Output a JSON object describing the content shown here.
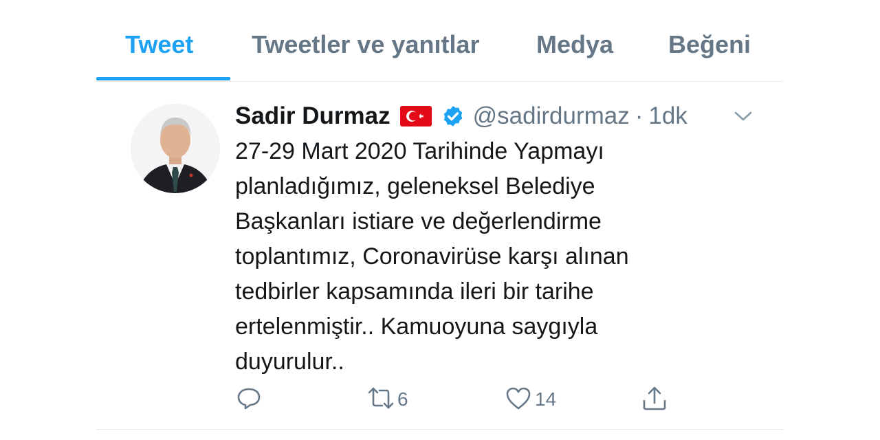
{
  "tabs": [
    {
      "label": "Tweet",
      "active": true
    },
    {
      "label": "Tweetler ve yanıtlar",
      "active": false
    },
    {
      "label": "Medya",
      "active": false
    },
    {
      "label": "Beğeni",
      "active": false
    }
  ],
  "tweet": {
    "author_name": "Sadir Durmaz",
    "handle": "@sadirdurmaz",
    "separator": "·",
    "time": "1dk",
    "text": "27-29 Mart 2020 Tarihinde Yapmayı\nplanladığımız, geleneksel Belediye\nBaşkanları istiare ve değerlendirme\ntoplantımız, Coronavirüse karşı alınan\ntedbirler kapsamında ileri bir tarihe\nertelenmiştir.. Kamuoyuna saygıyla\nduyurulur..",
    "retweet_count": "6",
    "like_count": "14"
  },
  "icons": {
    "flag": "turkey-flag-icon",
    "verified": "verified-badge-icon",
    "chevron": "chevron-down-icon",
    "reply": "reply-icon",
    "retweet": "retweet-icon",
    "like": "heart-icon",
    "share": "share-icon"
  },
  "colors": {
    "accent": "#1da1f2",
    "secondary_text": "#657786",
    "flag_red": "#e30a17"
  }
}
